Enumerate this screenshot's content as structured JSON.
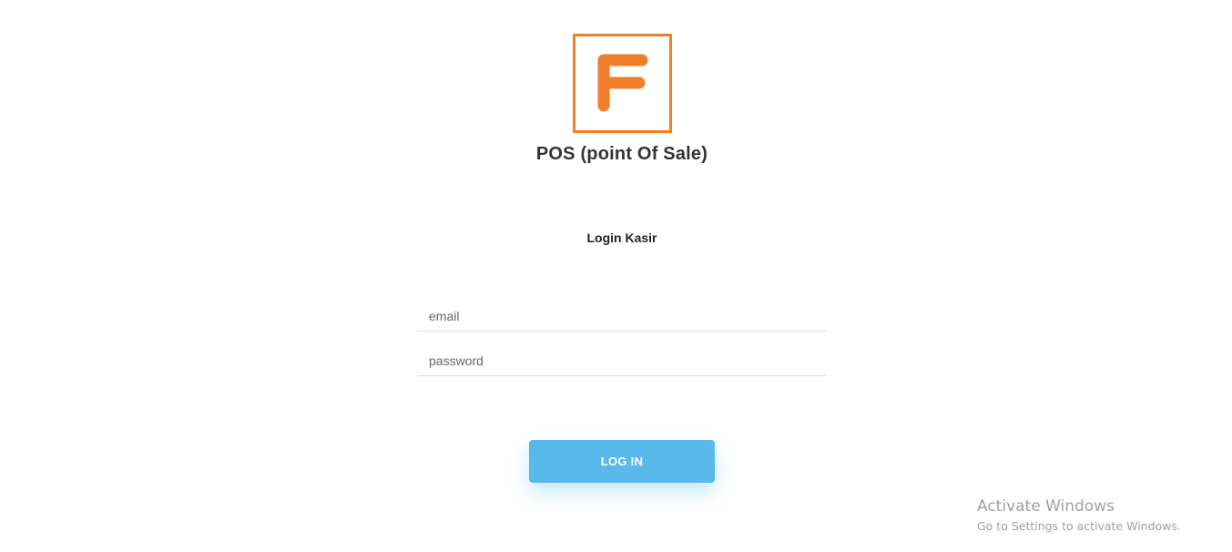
{
  "logo": {
    "letter": "F",
    "color": "#f07f2c"
  },
  "app_title": "POS (point Of Sale)",
  "login_heading": "Login Kasir",
  "form": {
    "email": {
      "value": "",
      "placeholder": "email"
    },
    "password": {
      "value": "",
      "placeholder": "password"
    },
    "submit_label": "LOG IN"
  },
  "watermark": {
    "title": "Activate Windows",
    "subtitle": "Go to Settings to activate Windows."
  },
  "colors": {
    "accent": "#58b9ea",
    "brand": "#f07f2c",
    "title_text": "#333333"
  }
}
